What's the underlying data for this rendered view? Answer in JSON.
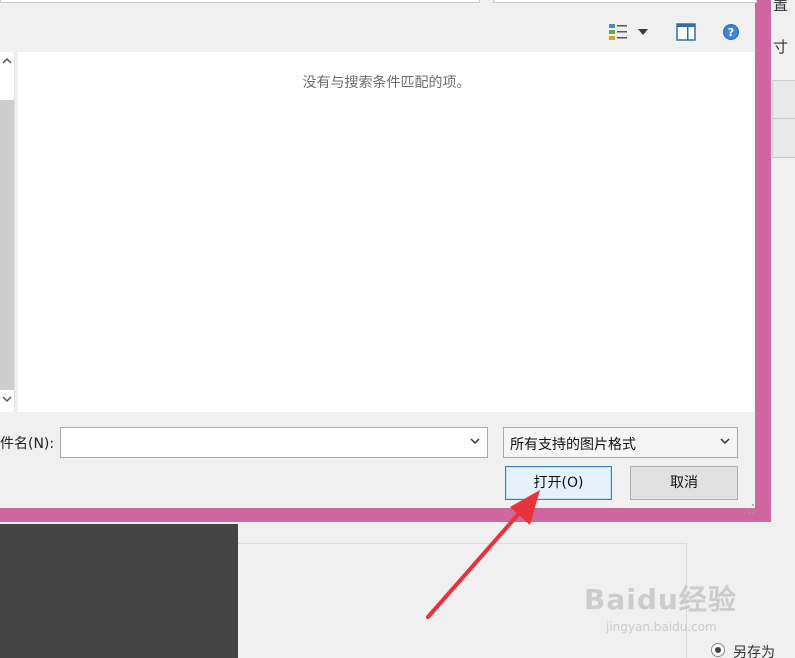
{
  "dialog": {
    "empty_message": "没有与搜索条件匹配的项。",
    "filename_label": "件名(N):",
    "filename_value": "",
    "filter_selected": "所有支持的图片格式",
    "open_label": "打开(O)",
    "cancel_label": "取消",
    "icons": [
      "change-view-icon",
      "view-dropdown-icon",
      "preview-pane-icon",
      "help-icon"
    ]
  },
  "background_app": {
    "side_text_1": "置",
    "side_text_2": "寸",
    "saveas_label": "另存为"
  },
  "watermark": {
    "main": "Baidu经验",
    "sub": "jingyan.baidu.com"
  },
  "colors": {
    "dialog_border": "#d066a0",
    "annotation_arrow": "#e8333a",
    "primary_button_border": "#3c7fb1"
  }
}
